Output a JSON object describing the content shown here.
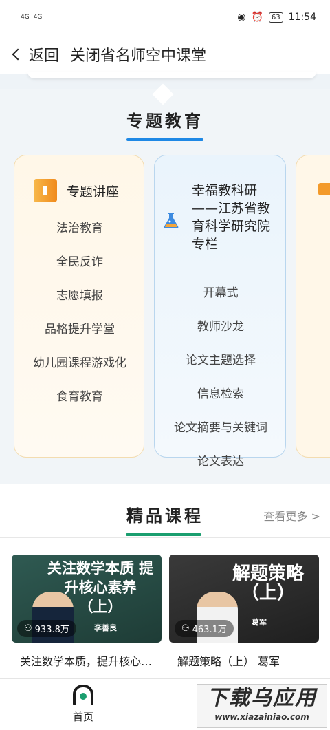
{
  "status": {
    "net1": "4G",
    "net2": "4G",
    "battery": "63",
    "time": "11:54"
  },
  "header": {
    "back_label": "返回",
    "title": "关闭省名师空中课堂"
  },
  "section1": {
    "title": "专题教育",
    "card1": {
      "title": "专题讲座",
      "items": [
        "法治教育",
        "全民反诈",
        "志愿填报",
        "品格提升学堂",
        "幼儿园课程游戏化",
        "食育教育"
      ]
    },
    "card2": {
      "title": "幸福教科研——江苏省教育科学研究院专栏",
      "items": [
        "开幕式",
        "教师沙龙",
        "论文主题选择",
        "信息检索",
        "论文摘要与关键词",
        "论文表达"
      ]
    }
  },
  "section2": {
    "title": "精品课程",
    "more": "查看更多 >",
    "courses": [
      {
        "board": "关注数学本质 提升核心素养 （上）",
        "teacher": "李善良",
        "views": "933.8万",
        "title": "关注数学本质，提升核心素养（上）"
      },
      {
        "board": "解题策略 （上）",
        "teacher": "葛军",
        "views": "463.1万",
        "title": "解题策略（上） 葛军"
      }
    ]
  },
  "tabbar": {
    "home": "首页"
  },
  "watermark": {
    "line1": "下载乌应用",
    "line2": "www.xiazainiao.com"
  }
}
